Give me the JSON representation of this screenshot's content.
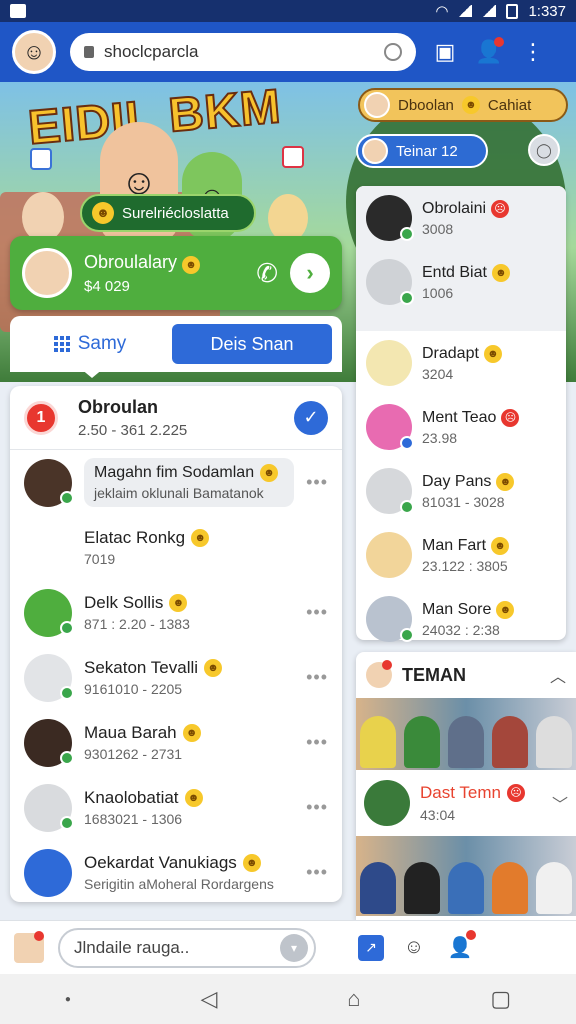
{
  "status_bar": {
    "time": "1:337"
  },
  "search": {
    "value": "shoclcparcla"
  },
  "hero": {
    "banner": "EIDIL BKM",
    "green_pill": "Surelriécloslatta",
    "pill_a": "Dboolan",
    "pill_a_tail": "Cahiat",
    "pill_b": "Teinar 12"
  },
  "green_card": {
    "name": "Obroulalary",
    "amount": "$4 029"
  },
  "tabs": {
    "active": "Samy",
    "button": "Deis Snan"
  },
  "left_panel": {
    "badge": "1",
    "title": "Obroulan",
    "subtitle": "2.50 - 361 2.225",
    "rows": [
      {
        "name": "Magahn fim Sodamlan",
        "sub": "jeklaim oklunali Bamatanok"
      },
      {
        "name": "Elatac Ronkg",
        "sub": "7019"
      },
      {
        "name": "Delk Sollis",
        "sub": "871 : 2.20 - 1383"
      },
      {
        "name": "Sekaton Tevalli",
        "sub": "9161010 - 2205"
      },
      {
        "name": "Maua Barah",
        "sub": "9301262 - 2731"
      },
      {
        "name": "Knaolobatiat",
        "sub": "1683021 - 1306"
      },
      {
        "name": "Oekardat Vanukiags",
        "sub": "Serigitin aMoheral Rordargens"
      }
    ]
  },
  "right_panel": {
    "rows": [
      {
        "name": "Obrolaini",
        "sub": "3008",
        "emoji": "red"
      },
      {
        "name": "Entd Biat",
        "sub": "1006",
        "emoji": "yellow"
      },
      {
        "name": "Dradapt",
        "sub": "3204",
        "emoji": "yellow"
      },
      {
        "name": "Ment Teao",
        "sub": "23.98",
        "emoji": "red"
      },
      {
        "name": "Day Pans",
        "sub": "81031 - 3028",
        "emoji": "yellow"
      },
      {
        "name": "Man Fart",
        "sub": "23.122 : 3805",
        "emoji": "yellow"
      },
      {
        "name": "Man Sore",
        "sub": "24032 : 2:38",
        "emoji": "yellow"
      }
    ]
  },
  "teman": {
    "title": "TEMAN",
    "dast_name": "Dast Temn",
    "dast_sub": "43:04"
  },
  "compose": {
    "placeholder": "Jlndaile rauga.."
  },
  "colors": {
    "primary": "#1f56c6",
    "accent": "#2e6ad8",
    "green": "#4fae3e",
    "alert": "#e8372f"
  }
}
